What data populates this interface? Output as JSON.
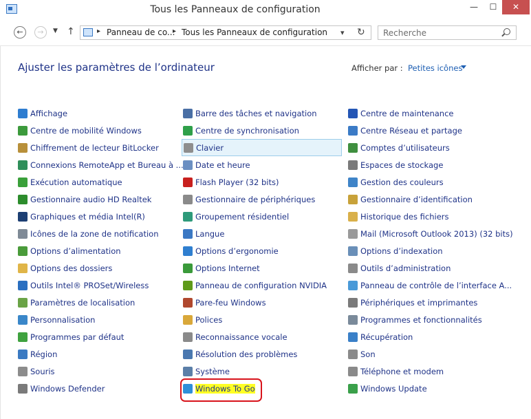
{
  "window": {
    "title": "Tous les Panneaux de configuration",
    "minimize_glyph": "—",
    "maximize_glyph": "☐",
    "close_glyph": "✕"
  },
  "address": {
    "crumbs": [
      "Panneau de co...",
      "Tous les Panneaux de configuration"
    ],
    "separator": "▸",
    "search_placeholder": "Recherche"
  },
  "header": {
    "title": "Ajuster les paramètres de l’ordinateur",
    "view_label": "Afficher par :",
    "view_value": "Petites icônes"
  },
  "columns": [
    [
      {
        "label": "Affichage",
        "icon": "display-icon",
        "color": "#2e7dd0"
      },
      {
        "label": "Centre de mobilité Windows",
        "icon": "mobility-center-icon",
        "color": "#3c9a3c"
      },
      {
        "label": "Chiffrement de lecteur BitLocker",
        "icon": "bitlocker-icon",
        "color": "#b8903a"
      },
      {
        "label": "Connexions RemoteApp et Bureau à ...",
        "icon": "remoteapp-icon",
        "color": "#2f8f5a"
      },
      {
        "label": "Exécution automatique",
        "icon": "autoplay-icon",
        "color": "#3aa03a"
      },
      {
        "label": "Gestionnaire audio HD Realtek",
        "icon": "realtek-audio-icon",
        "color": "#2c8c2c"
      },
      {
        "label": "Graphiques et média Intel(R)",
        "icon": "intel-graphics-icon",
        "color": "#1d3f73"
      },
      {
        "label": "Icônes de la zone de notification",
        "icon": "notification-area-icon",
        "color": "#7f8a96"
      },
      {
        "label": "Options d’alimentation",
        "icon": "power-icon",
        "color": "#4a9b3a"
      },
      {
        "label": "Options des dossiers",
        "icon": "folder-options-icon",
        "color": "#e0b548"
      },
      {
        "label": "Outils Intel® PROSet/Wireless",
        "icon": "intel-wireless-icon",
        "color": "#2a6fc0"
      },
      {
        "label": "Paramètres de localisation",
        "icon": "location-icon",
        "color": "#6aa346"
      },
      {
        "label": "Personnalisation",
        "icon": "personalization-icon",
        "color": "#3a87c9"
      },
      {
        "label": "Programmes par défaut",
        "icon": "default-programs-icon",
        "color": "#3fa23f"
      },
      {
        "label": "Région",
        "icon": "region-icon",
        "color": "#3a7ac2"
      },
      {
        "label": "Souris",
        "icon": "mouse-icon",
        "color": "#8c8c8c"
      },
      {
        "label": "Windows Defender",
        "icon": "defender-icon",
        "color": "#7a7a7a"
      }
    ],
    [
      {
        "label": "Barre des tâches et navigation",
        "icon": "taskbar-icon",
        "color": "#4a6fa5"
      },
      {
        "label": "Centre de synchronisation",
        "icon": "sync-center-icon",
        "color": "#2fa04a"
      },
      {
        "label": "Clavier",
        "icon": "keyboard-icon",
        "color": "#8e8e8e",
        "hover": true
      },
      {
        "label": "Date et heure",
        "icon": "date-time-icon",
        "color": "#6b8fc2"
      },
      {
        "label": "Flash Player (32 bits)",
        "icon": "flash-player-icon",
        "color": "#c8201e"
      },
      {
        "label": "Gestionnaire de périphériques",
        "icon": "device-manager-icon",
        "color": "#8a8a8a"
      },
      {
        "label": "Groupement résidentiel",
        "icon": "homegroup-icon",
        "color": "#2e9a7a"
      },
      {
        "label": "Langue",
        "icon": "language-icon",
        "color": "#3b78c4"
      },
      {
        "label": "Options d’ergonomie",
        "icon": "ease-of-access-icon",
        "color": "#2f7fd0"
      },
      {
        "label": "Options Internet",
        "icon": "internet-options-icon",
        "color": "#3a9a3a"
      },
      {
        "label": "Panneau de configuration NVIDIA",
        "icon": "nvidia-icon",
        "color": "#5f9a1a"
      },
      {
        "label": "Pare-feu Windows",
        "icon": "firewall-icon",
        "color": "#b0482e"
      },
      {
        "label": "Polices",
        "icon": "fonts-icon",
        "color": "#d9a83a"
      },
      {
        "label": "Reconnaissance vocale",
        "icon": "microphone-icon",
        "color": "#8a8a8a"
      },
      {
        "label": "Résolution des problèmes",
        "icon": "troubleshooting-icon",
        "color": "#4a78b0"
      },
      {
        "label": "Système",
        "icon": "system-icon",
        "color": "#5b7fa8"
      },
      {
        "label": "Windows To Go",
        "icon": "windows-to-go-icon",
        "color": "#2f8fd8",
        "highlight": true
      }
    ],
    [
      {
        "label": "Centre de maintenance",
        "icon": "maintenance-flag-icon",
        "color": "#2456b5"
      },
      {
        "label": "Centre Réseau et partage",
        "icon": "network-icon",
        "color": "#3b7bc6"
      },
      {
        "label": "Comptes d’utilisateurs",
        "icon": "user-accounts-icon",
        "color": "#3f8f3f"
      },
      {
        "label": "Espaces de stockage",
        "icon": "storage-spaces-icon",
        "color": "#7a7a7a"
      },
      {
        "label": "Gestion des couleurs",
        "icon": "color-management-icon",
        "color": "#3f84c8"
      },
      {
        "label": "Gestionnaire d’identification",
        "icon": "credential-manager-icon",
        "color": "#c8a23a"
      },
      {
        "label": "Historique des fichiers",
        "icon": "file-history-icon",
        "color": "#d9b04a"
      },
      {
        "label": "Mail (Microsoft Outlook 2013) (32 bits)",
        "icon": "mail-icon",
        "color": "#9a9a9a"
      },
      {
        "label": "Options d’indexation",
        "icon": "indexing-icon",
        "color": "#6a8fb8"
      },
      {
        "label": "Outils d’administration",
        "icon": "admin-tools-icon",
        "color": "#8a8a8a"
      },
      {
        "label": "Panneau de contrôle de l’interface A...",
        "icon": "interface-panel-icon",
        "color": "#4a9ad8"
      },
      {
        "label": "Périphériques et imprimantes",
        "icon": "printer-icon",
        "color": "#7a7a7a"
      },
      {
        "label": "Programmes et fonctionnalités",
        "icon": "programs-icon",
        "color": "#7a8a9a"
      },
      {
        "label": "Récupération",
        "icon": "recovery-icon",
        "color": "#3a80c8"
      },
      {
        "label": "Son",
        "icon": "sound-icon",
        "color": "#8a8a8a"
      },
      {
        "label": "Téléphone et modem",
        "icon": "phone-modem-icon",
        "color": "#8a8a8a"
      },
      {
        "label": "Windows Update",
        "icon": "windows-update-icon",
        "color": "#3aa04a"
      }
    ]
  ]
}
